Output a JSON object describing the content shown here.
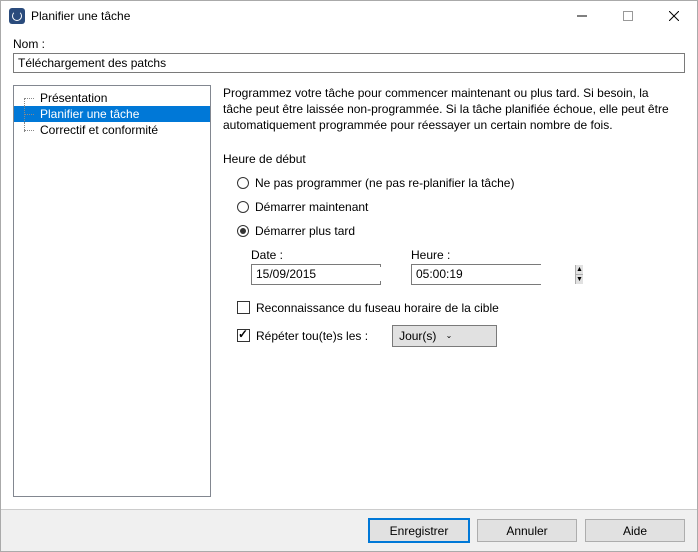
{
  "window": {
    "title": "Planifier une tâche"
  },
  "name": {
    "label": "Nom :",
    "value": "Téléchargement des patchs"
  },
  "sidebar": {
    "items": [
      "Présentation",
      "Planifier une tâche",
      "Correctif et conformité"
    ],
    "selected_index": 1
  },
  "main": {
    "description": "Programmez votre tâche pour commencer maintenant ou plus tard. Si besoin, la tâche peut être laissée non-programmée. Si la tâche planifiée échoue, elle peut être automatiquement programmée pour réessayer un certain nombre de fois.",
    "start_heading": "Heure de début",
    "radios": {
      "none": "Ne pas programmer (ne pas re-planifier la tâche)",
      "now": "Démarrer maintenant",
      "later": "Démarrer plus tard",
      "selected": "later"
    },
    "date": {
      "label": "Date :",
      "value": "15/09/2015"
    },
    "time": {
      "label": "Heure :",
      "value": "05:00:19"
    },
    "tz_check": {
      "label": "Reconnaissance du fuseau horaire de la cible",
      "checked": false
    },
    "repeat": {
      "label": "Répéter tou(te)s les :",
      "checked": true,
      "unit": "Jour(s)"
    }
  },
  "buttons": {
    "save": "Enregistrer",
    "cancel": "Annuler",
    "help": "Aide"
  }
}
